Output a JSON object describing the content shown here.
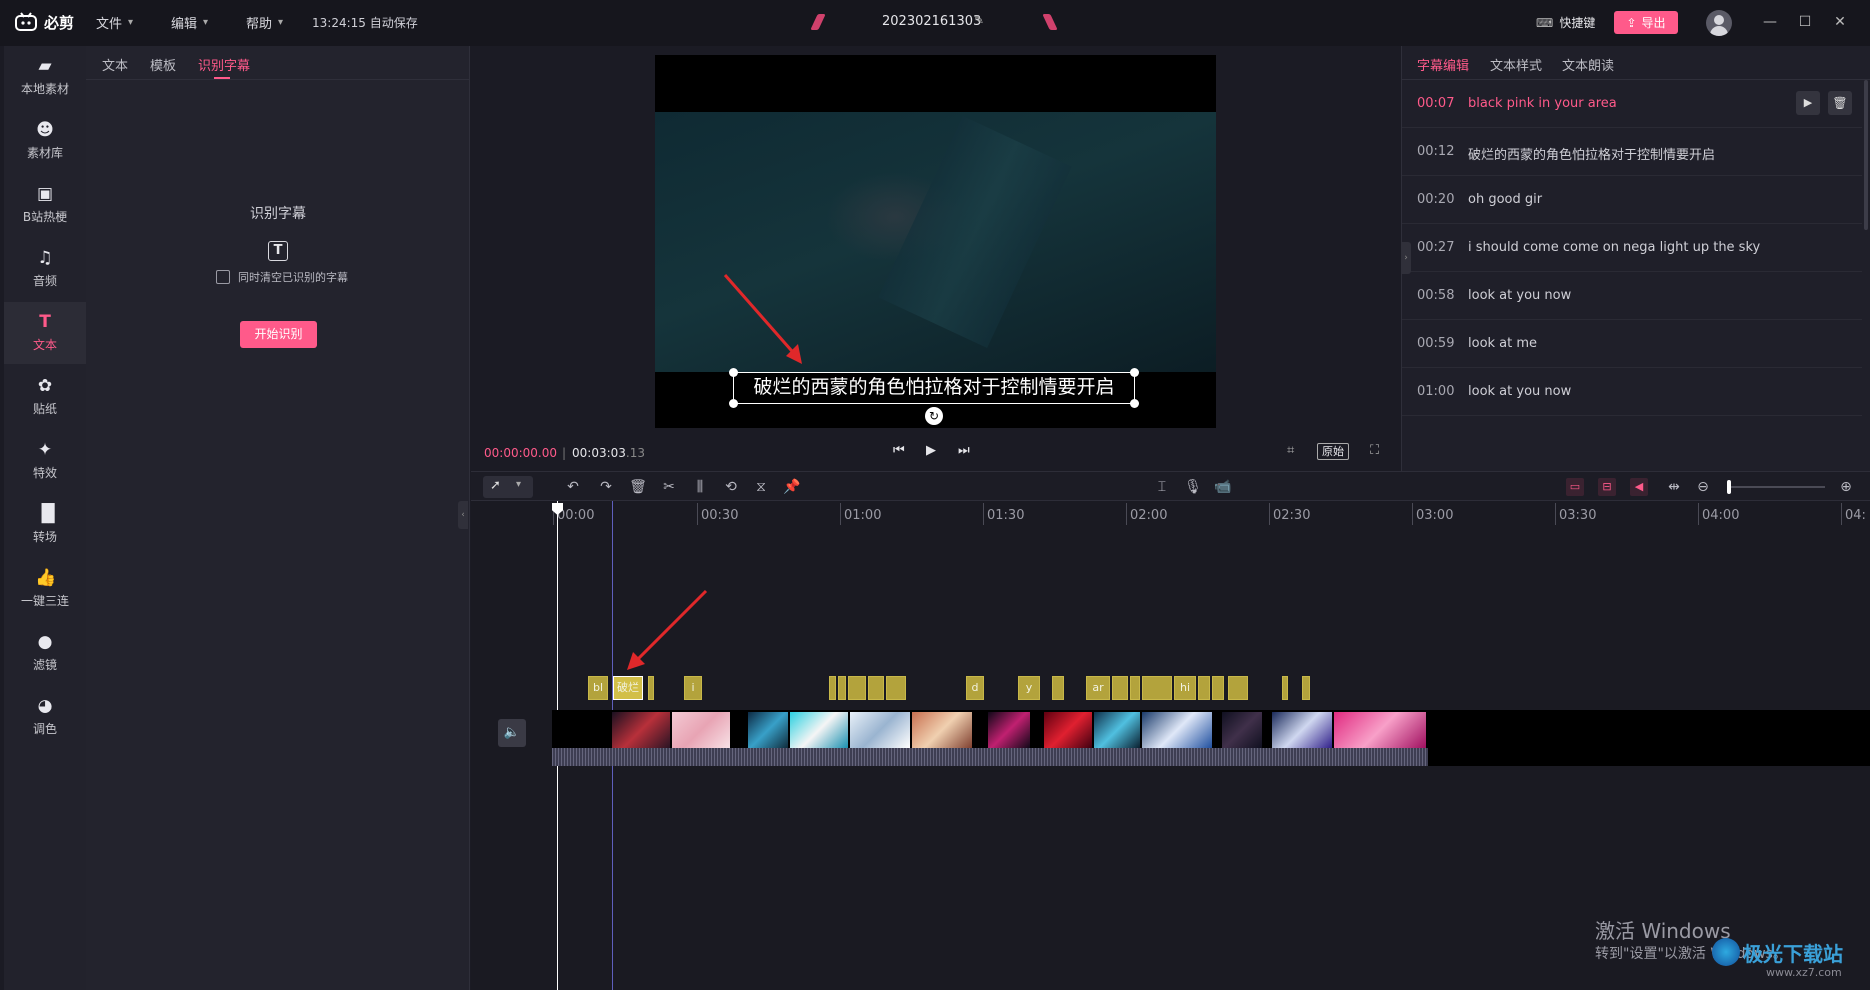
{
  "app": {
    "logo": "必剪",
    "menus": [
      "文件",
      "编辑",
      "帮助"
    ],
    "autosave": "13:24:15 自动保存",
    "project_name": "202302161303",
    "shortcut_label": "快捷键",
    "export_label": "导出"
  },
  "sidebar": {
    "items": [
      {
        "label": "本地素材",
        "icon": "folder-upload-icon"
      },
      {
        "label": "素材库",
        "icon": "skull-icon"
      },
      {
        "label": "B站热梗",
        "icon": "tv-icon"
      },
      {
        "label": "音频",
        "icon": "music-note-icon"
      },
      {
        "label": "文本",
        "icon": "text-t-icon"
      },
      {
        "label": "贴纸",
        "icon": "sticker-icon"
      },
      {
        "label": "特效",
        "icon": "sparkle-icon"
      },
      {
        "label": "转场",
        "icon": "transition-icon"
      },
      {
        "label": "一键三连",
        "icon": "thumbs-up-icon"
      },
      {
        "label": "滤镜",
        "icon": "filter-icon"
      },
      {
        "label": "调色",
        "icon": "palette-icon"
      }
    ]
  },
  "left_panel": {
    "tabs": [
      "文本",
      "模板",
      "识别字幕"
    ],
    "heading": "识别字幕",
    "checkbox_label": "同时清空已识别的字幕",
    "start_button": "开始识别"
  },
  "preview": {
    "subtitle_text": "破烂的西蒙的角色怕拉格对于控制情要开启",
    "current_time": "00:00:00.00",
    "total_time_main": "00:03:03",
    "total_time_frac": ".13",
    "ratio_label": "原始"
  },
  "right_panel": {
    "tabs": [
      "字幕编辑",
      "文本样式",
      "文本朗读"
    ],
    "subtitles": [
      {
        "time": "00:07",
        "text": "black pink in your area"
      },
      {
        "time": "00:12",
        "text": "破烂的西蒙的角色怕拉格对于控制情要开启"
      },
      {
        "time": "00:20",
        "text": "oh good gir"
      },
      {
        "time": "00:27",
        "text": "i should come come on nega light up the sky"
      },
      {
        "time": "00:58",
        "text": "look at you now"
      },
      {
        "time": "00:59",
        "text": "look at me"
      },
      {
        "time": "01:00",
        "text": "look at you now"
      }
    ]
  },
  "timeline": {
    "ticks": [
      "00:00",
      "00:30",
      "01:00",
      "01:30",
      "02:00",
      "02:30",
      "03:00",
      "03:30",
      "04:00",
      "04:"
    ],
    "chips": [
      {
        "label": "bl"
      },
      {
        "label": "破烂"
      },
      {
        "label": ""
      },
      {
        "label": "i"
      },
      {
        "label": ""
      },
      {
        "label": ""
      },
      {
        "label": ""
      },
      {
        "label": ""
      },
      {
        "label": ""
      },
      {
        "label": "d"
      },
      {
        "label": "y"
      },
      {
        "label": ""
      },
      {
        "label": "ar"
      },
      {
        "label": ""
      },
      {
        "label": ""
      },
      {
        "label": ""
      },
      {
        "label": "hi"
      },
      {
        "label": ""
      },
      {
        "label": ""
      },
      {
        "label": ""
      },
      {
        "label": ""
      },
      {
        "label": ""
      }
    ]
  },
  "watermark": {
    "line1": "激活 Windows",
    "line2": "转到\"设置\"以激活 Windows。",
    "site": "极光下载站",
    "site_url": "www.xz7.com"
  },
  "colors": {
    "accent": "#ff5a8a",
    "subtitle_chip": "#b3a33c",
    "background": "#1b1b24"
  }
}
